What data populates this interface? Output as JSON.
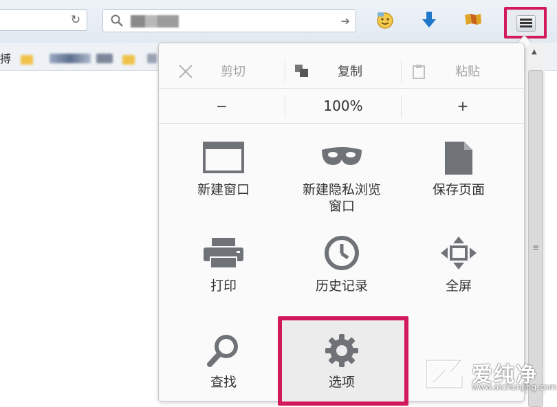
{
  "toolbar": {
    "reload_icon": "reload-icon",
    "search": {
      "icon": "search-icon",
      "go_icon": "arrow-right-icon"
    },
    "icons": [
      "smiley-icon",
      "download-icon",
      "extension-icon"
    ],
    "menu_icon": "hamburger-menu-icon"
  },
  "bookmarks": {
    "partial_text": "搏"
  },
  "menu": {
    "edit": {
      "cut": "剪切",
      "copy": "复制",
      "paste": "粘贴"
    },
    "zoom": {
      "minus": "−",
      "level": "100%",
      "plus": "+"
    },
    "items": [
      {
        "label": "新建窗口",
        "icon": "new-window-icon"
      },
      {
        "label": "新建隐私浏览窗口",
        "icon": "private-mask-icon"
      },
      {
        "label": "保存页面",
        "icon": "save-page-icon"
      },
      {
        "label": "打印",
        "icon": "printer-icon"
      },
      {
        "label": "历史记录",
        "icon": "history-clock-icon"
      },
      {
        "label": "全屏",
        "icon": "fullscreen-icon"
      },
      {
        "label": "查找",
        "icon": "find-magnifier-icon"
      },
      {
        "label": "选项",
        "icon": "options-gear-icon"
      }
    ]
  },
  "watermark": {
    "title": "爱纯净",
    "url": "www.aichunjing.com"
  },
  "colors": {
    "highlight": "#d1195b",
    "icon": "#6f7378"
  }
}
